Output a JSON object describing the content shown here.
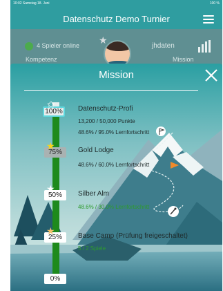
{
  "status_bar": {
    "left": "10:02 Samstag 18. Juni",
    "right": "100 %"
  },
  "app": {
    "title": "Datenschutz Demo Turnier"
  },
  "header": {
    "online_text": "4 Spieler online",
    "kompetenz_label": "Kompetenz",
    "username": "jhdaten",
    "mission_label": "Mission"
  },
  "mission": {
    "title": "Mission",
    "progress_percent": 75,
    "milestones": [
      {
        "percent_label": "100%",
        "title": "Datenschutz-Profi",
        "line1": "13,200 / 50,000 Punkte",
        "line2": "48.6% / 95.0% Lernfortschritt",
        "line2_green": false,
        "star": "outline"
      },
      {
        "percent_label": "75%",
        "title": "Gold Lodge",
        "line1": "48.6% / 60.0% Lernfortschritt",
        "line2": "",
        "line1_green": false,
        "star": "gold"
      },
      {
        "percent_label": "50%",
        "title": "Silber Alm",
        "line1": "48.6% / 30.0% Lernfortschritt",
        "line2": "",
        "line1_green": true,
        "star": "silver"
      },
      {
        "percent_label": "25%",
        "title": "Base Camp (Prüfung freigeschaltet)",
        "line1": "5 / 2 Spiele",
        "line2": "",
        "line1_green": true,
        "star": "bronze"
      },
      {
        "percent_label": "0%",
        "title": "",
        "line1": "",
        "line2": "",
        "star": "none"
      }
    ]
  },
  "colors": {
    "accent": "#2f9da0",
    "track_green": "#1e8a1c",
    "complete_green": "#2e9b2e",
    "gold_star": "#f7d31c",
    "badge_active": "#5fd6dc"
  }
}
